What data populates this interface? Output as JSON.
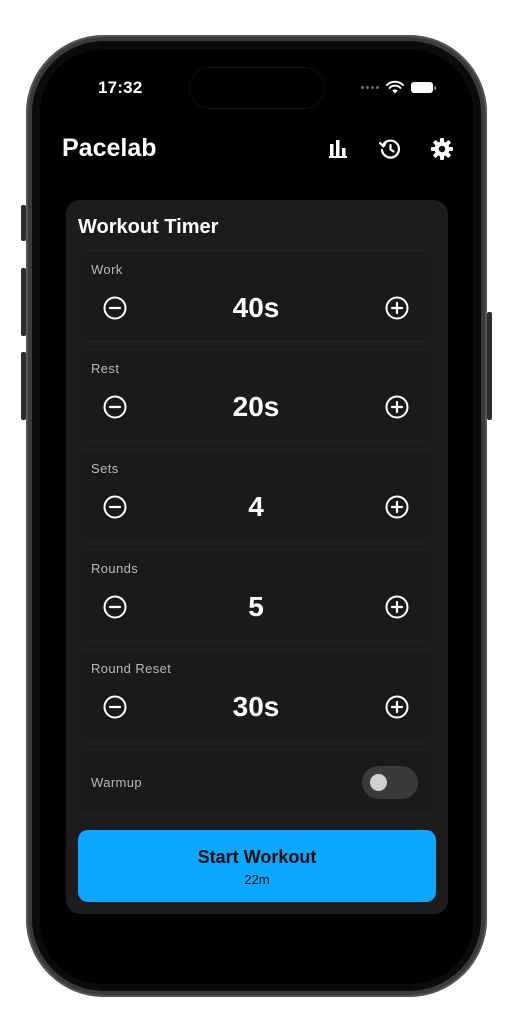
{
  "status_bar": {
    "time": "17:32"
  },
  "header": {
    "app_title": "Pacelab",
    "icons": [
      "bar-chart-icon",
      "history-icon",
      "gear-icon"
    ]
  },
  "card": {
    "title": "Workout Timer",
    "steppers": [
      {
        "label": "Work",
        "value": "40s"
      },
      {
        "label": "Rest",
        "value": "20s"
      },
      {
        "label": "Sets",
        "value": "4"
      },
      {
        "label": "Rounds",
        "value": "5"
      },
      {
        "label": "Round Reset",
        "value": "30s"
      }
    ],
    "warmup": {
      "label": "Warmup",
      "enabled": false
    }
  },
  "start_button": {
    "label": "Start Workout",
    "duration": "22m"
  },
  "colors": {
    "accent": "#0aa9ff",
    "card_bg": "#1c1c1e",
    "screen_bg": "#000000"
  }
}
